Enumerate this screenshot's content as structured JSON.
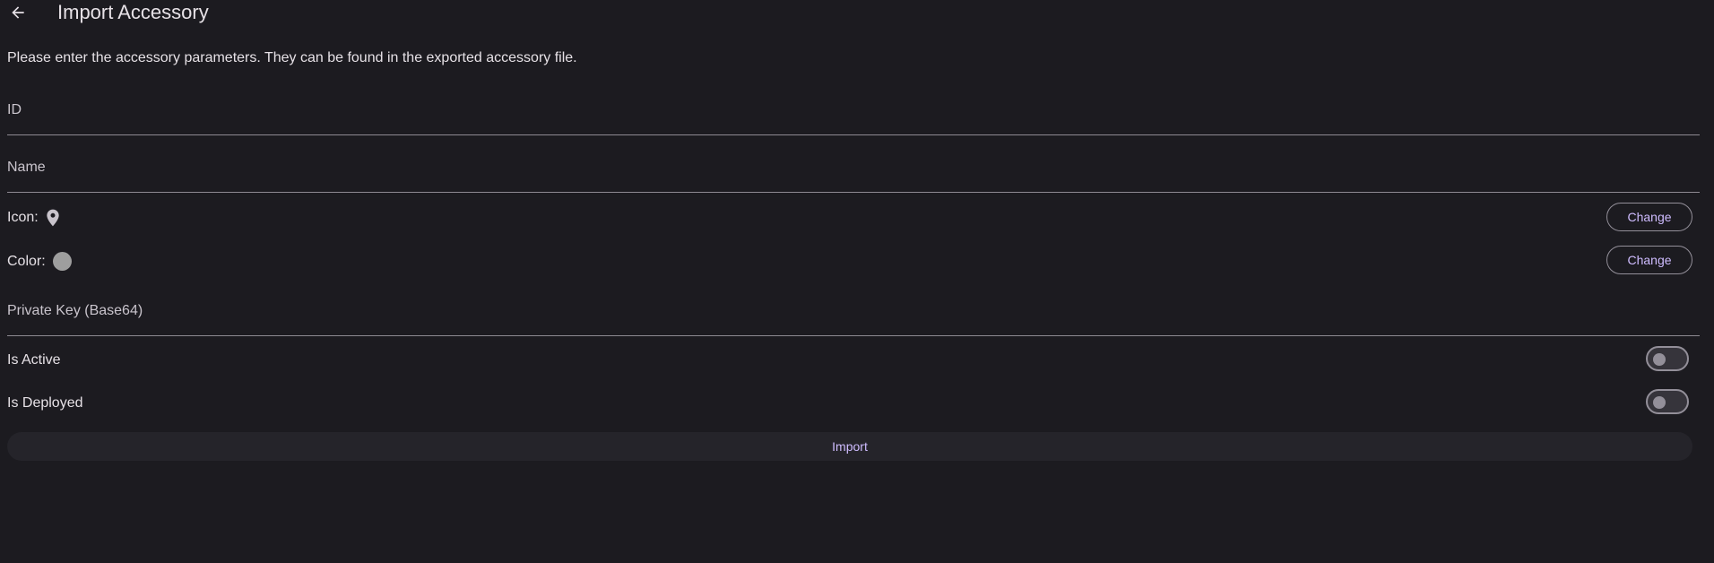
{
  "appbar": {
    "back_icon": "arrow-back-icon",
    "title": "Import Accessory"
  },
  "intro_text": "Please enter the accessory parameters. They can be found in the exported accessory file.",
  "fields": {
    "id": {
      "label": "ID",
      "value": ""
    },
    "name": {
      "label": "Name",
      "value": ""
    },
    "private_key": {
      "label": "Private Key (Base64)",
      "value": ""
    }
  },
  "icon_row": {
    "label": "Icon:",
    "icon": "location-pin-icon",
    "button_label": "Change"
  },
  "color_row": {
    "label": "Color:",
    "color": "#9e9e9e",
    "button_label": "Change"
  },
  "toggles": {
    "is_active": {
      "label": "Is Active",
      "checked": false
    },
    "is_deployed": {
      "label": "Is Deployed",
      "checked": false
    }
  },
  "import_button_label": "Import",
  "colors": {
    "background": "#1c1b20",
    "accent": "#cfbcff",
    "outline": "#938f99"
  }
}
